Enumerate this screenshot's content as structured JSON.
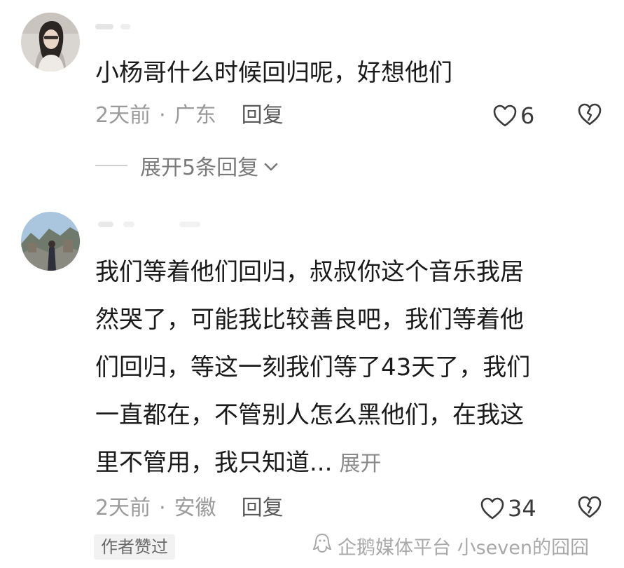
{
  "comments": [
    {
      "text_lines": [
        "小杨哥什么时候回归呢，好想他们"
      ],
      "time": "2天前",
      "location": "广东",
      "reply_label": "回复",
      "likes": "6",
      "expand_replies": "展开5条回复"
    },
    {
      "text_lines": [
        "我们等着他们回归，叔叔你这个音乐我居",
        "然哭了，可能我比较善良吧，我们等着他",
        "们回归，等这一刻我们等了43天了，我们",
        "一直都在，不管别人怎么黑他们，在我这",
        "里不管用，我只知道..."
      ],
      "expand_label": "展开",
      "time": "2天前",
      "location": "安徽",
      "reply_label": "回复",
      "likes": "34",
      "author_badge": "作者赞过"
    }
  ],
  "separator": "·",
  "watermark": "企鹅媒体平台 小seven的囧囧",
  "icons": {
    "like": "heart-outline-icon",
    "dislike": "broken-heart-icon",
    "expand": "chevron-down-icon",
    "watermark": "penguin-logo-icon"
  },
  "colors": {
    "text": "#1a1a1a",
    "meta": "#9a9a9a",
    "reply": "#5a5a5a",
    "badge_bg": "#f2f2f2"
  }
}
